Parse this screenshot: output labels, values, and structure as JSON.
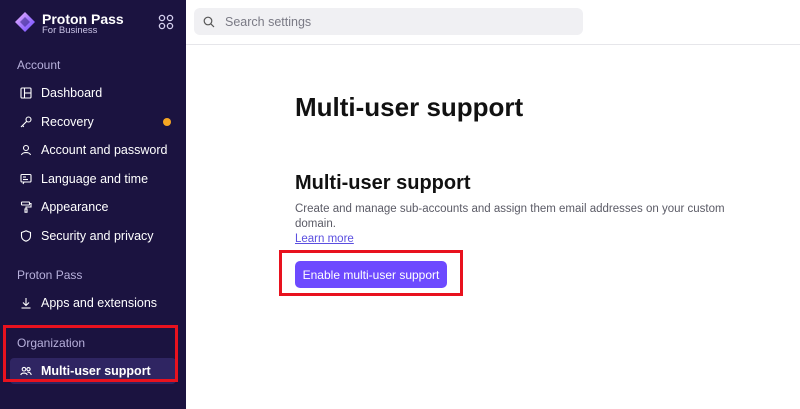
{
  "brand": {
    "title": "Proton Pass",
    "subtitle": "For Business"
  },
  "search": {
    "placeholder": "Search settings"
  },
  "sidebar": {
    "sections": [
      {
        "label": "Account"
      },
      {
        "label": "Proton Pass"
      },
      {
        "label": "Organization"
      }
    ],
    "account_items": [
      {
        "label": "Dashboard",
        "icon": "dashboard-icon"
      },
      {
        "label": "Recovery",
        "icon": "key-icon",
        "badge": "warning-dot"
      },
      {
        "label": "Account and password",
        "icon": "user-icon"
      },
      {
        "label": "Language and time",
        "icon": "language-icon"
      },
      {
        "label": "Appearance",
        "icon": "paint-roller-icon"
      },
      {
        "label": "Security and privacy",
        "icon": "shield-icon"
      }
    ],
    "pass_items": [
      {
        "label": "Apps and extensions",
        "icon": "download-icon"
      }
    ],
    "org_items": [
      {
        "label": "Multi-user support",
        "icon": "users-icon",
        "active": true
      }
    ]
  },
  "main": {
    "page_title": "Multi-user support",
    "section_title": "Multi-user support",
    "description": "Create and manage sub-accounts and assign them email addresses on your custom domain.",
    "learn_more": "Learn more",
    "enable_button": "Enable multi-user support"
  },
  "colors": {
    "sidebar_bg": "#1b1340",
    "accent": "#6d4aff",
    "highlight": "#e8121e",
    "badge": "#f5a623"
  }
}
